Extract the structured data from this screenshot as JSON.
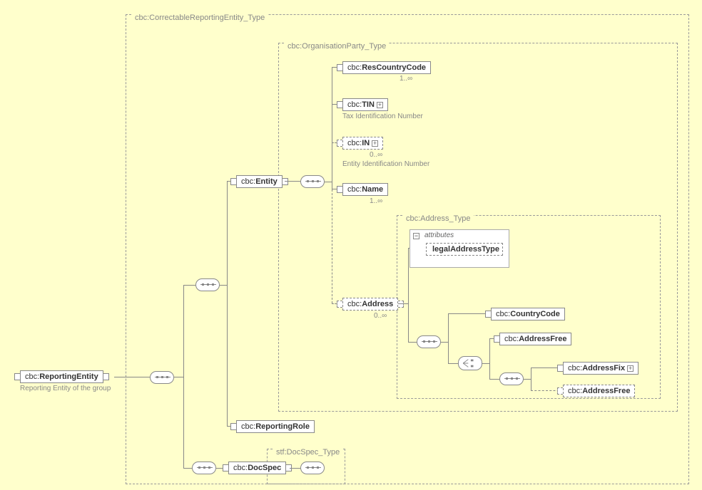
{
  "groups": {
    "correctable": "cbc:CorrectableReportingEntity_Type",
    "orgparty": "cbc:OrganisationParty_Type",
    "address": "cbc:Address_Type",
    "docspec": "stf:DocSpec_Type"
  },
  "root": {
    "reportingEntity": {
      "prefix": "cbc:",
      "name": "ReportingEntity"
    },
    "reportingEntityDesc": "Reporting Entity of the group"
  },
  "children": {
    "entity": {
      "prefix": "cbc:",
      "name": "Entity"
    },
    "reportingRole": {
      "prefix": "cbc:",
      "name": "ReportingRole"
    },
    "docSpec": {
      "prefix": "cbc:",
      "name": "DocSpec"
    }
  },
  "entityChildren": {
    "resCountry": {
      "prefix": "cbc:",
      "name": "ResCountryCode",
      "card": "1..∞"
    },
    "tin": {
      "prefix": "cbc:",
      "name": "TIN",
      "desc": "Tax Identification Number"
    },
    "in": {
      "prefix": "cbc:",
      "name": "IN",
      "card": "0..∞",
      "desc": "Entity Identification Number"
    },
    "name": {
      "prefix": "cbc:",
      "name": "Name",
      "card": "1..∞"
    },
    "address": {
      "prefix": "cbc:",
      "name": "Address",
      "card": "0..∞"
    }
  },
  "addressBlock": {
    "attributesLabel": "attributes",
    "legalAddressType": "legalAddressType",
    "countryCode": {
      "prefix": "cbc:",
      "name": "CountryCode"
    },
    "addressFree1": {
      "prefix": "cbc:",
      "name": "AddressFree"
    },
    "addressFix": {
      "prefix": "cbc:",
      "name": "AddressFix"
    },
    "addressFree2": {
      "prefix": "cbc:",
      "name": "AddressFree"
    }
  }
}
